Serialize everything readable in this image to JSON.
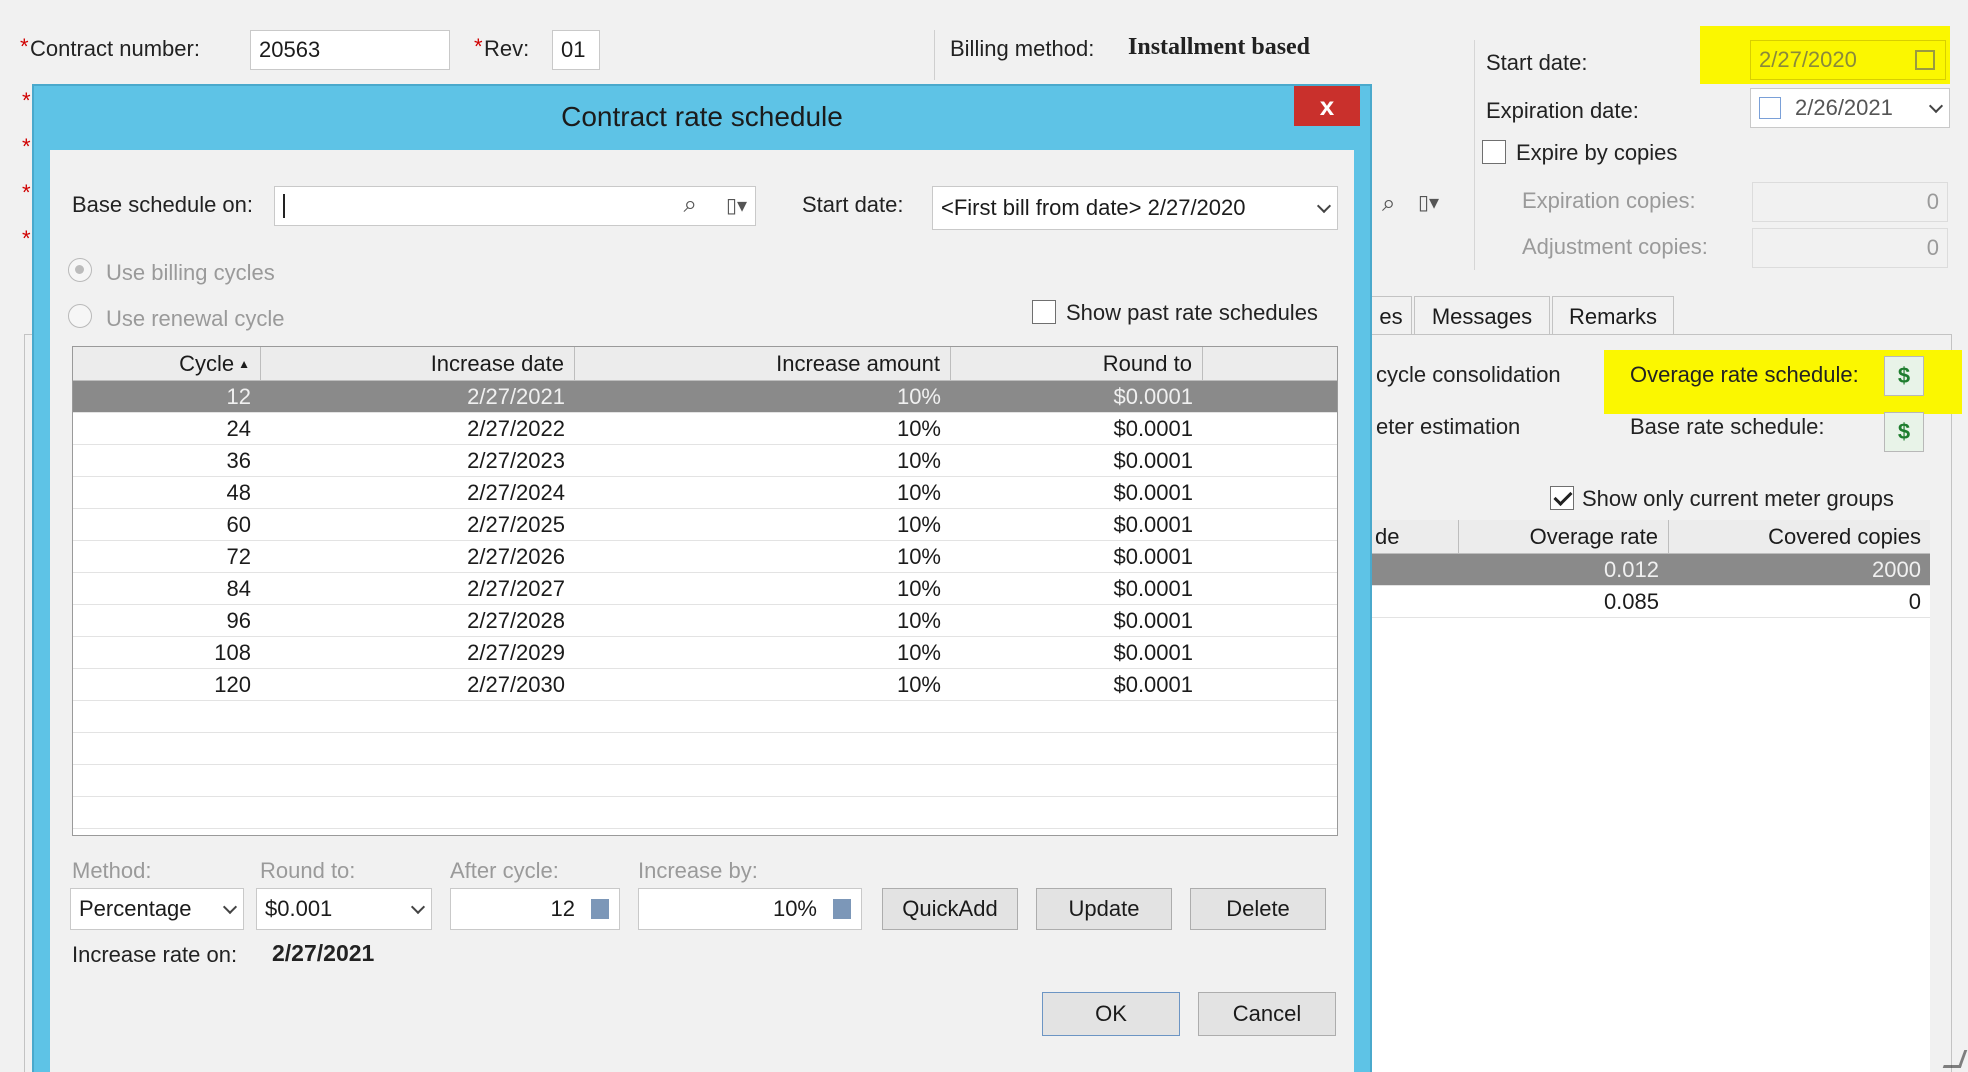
{
  "main": {
    "contract_number_label": "Contract number:",
    "contract_number": "20563",
    "rev_label": "Rev:",
    "rev": "01",
    "billing_method_label": "Billing method:",
    "billing_method": "Installment based",
    "start_date_label": "Start date:",
    "start_date": "2/27/2020",
    "expiration_date_label": "Expiration date:",
    "expiration_date": "2/26/2021",
    "expire_by_copies_label": "Expire by copies",
    "expiration_copies_label": "Expiration copies:",
    "expiration_copies": "0",
    "adjustment_copies_label": "Adjustment copies:",
    "adjustment_copies": "0",
    "tabs": [
      {
        "label": "es"
      },
      {
        "label": "Messages"
      },
      {
        "label": "Remarks"
      }
    ],
    "cycle_consolidation_label": "cycle consolidation",
    "meter_estimation_label": "eter estimation",
    "overage_rate_schedule_label": "Overage rate schedule:",
    "base_rate_schedule_label": "Base rate schedule:",
    "show_only_current_label": "Show only current meter groups",
    "meter_columns": [
      "de",
      "Overage rate",
      "Covered copies"
    ],
    "meter_rows": [
      {
        "overage_rate": "0.012",
        "covered_copies": "2000"
      },
      {
        "overage_rate": "0.085",
        "covered_copies": "0"
      }
    ],
    "highlight_color": "#fbf700"
  },
  "dialog": {
    "title": "Contract rate schedule",
    "close_label": "x",
    "base_schedule_label": "Base schedule on:",
    "base_schedule_value": "",
    "start_date_label": "Start date:",
    "start_date_value": "<First bill from date> 2/27/2020",
    "use_billing_cycles_label": "Use billing cycles",
    "use_renewal_cycle_label": "Use renewal cycle",
    "show_past_label": "Show past rate schedules",
    "columns": [
      "Cycle",
      "Increase date",
      "Increase amount",
      "Round to"
    ],
    "rows": [
      {
        "cycle": "12",
        "date": "2/27/2021",
        "amount": "10%",
        "round": "$0.0001"
      },
      {
        "cycle": "24",
        "date": "2/27/2022",
        "amount": "10%",
        "round": "$0.0001"
      },
      {
        "cycle": "36",
        "date": "2/27/2023",
        "amount": "10%",
        "round": "$0.0001"
      },
      {
        "cycle": "48",
        "date": "2/27/2024",
        "amount": "10%",
        "round": "$0.0001"
      },
      {
        "cycle": "60",
        "date": "2/27/2025",
        "amount": "10%",
        "round": "$0.0001"
      },
      {
        "cycle": "72",
        "date": "2/27/2026",
        "amount": "10%",
        "round": "$0.0001"
      },
      {
        "cycle": "84",
        "date": "2/27/2027",
        "amount": "10%",
        "round": "$0.0001"
      },
      {
        "cycle": "96",
        "date": "2/27/2028",
        "amount": "10%",
        "round": "$0.0001"
      },
      {
        "cycle": "108",
        "date": "2/27/2029",
        "amount": "10%",
        "round": "$0.0001"
      },
      {
        "cycle": "120",
        "date": "2/27/2030",
        "amount": "10%",
        "round": "$0.0001"
      }
    ],
    "method_label": "Method:",
    "method_value": "Percentage",
    "round_to_label": "Round to:",
    "round_to_value": "$0.001",
    "after_cycle_label": "After cycle:",
    "after_cycle_value": "12",
    "increase_by_label": "Increase by:",
    "increase_by_value": "10%",
    "quickadd_label": "QuickAdd",
    "update_label": "Update",
    "delete_label": "Delete",
    "increase_rate_on_label": "Increase rate on:",
    "increase_rate_on_value": "2/27/2021",
    "ok_label": "OK",
    "cancel_label": "Cancel",
    "title_bar_color": "#5ec3e6",
    "close_color": "#c9302c"
  }
}
